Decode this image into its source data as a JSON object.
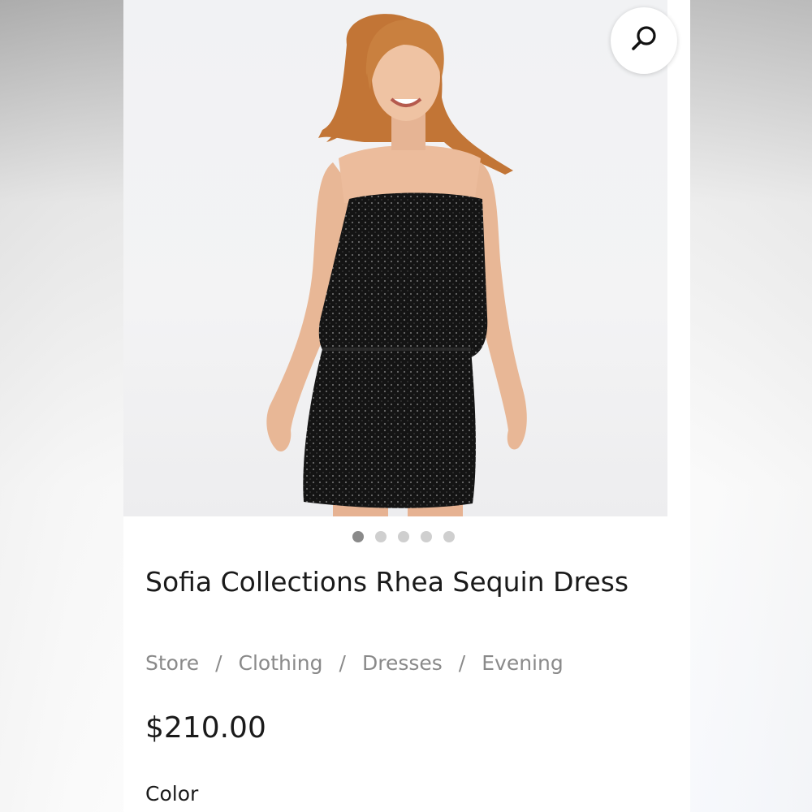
{
  "product": {
    "title": "Sofia Collections Rhea Sequin Dress",
    "price": "$210.00",
    "image_alt": "model-wearing-black-sequin-strapless-dress"
  },
  "breadcrumb": {
    "items": [
      "Store",
      "Clothing",
      "Dresses",
      "Evening"
    ],
    "separator": "/"
  },
  "carousel": {
    "total": 5,
    "active_index": 0
  },
  "options": {
    "color_label": "Color"
  },
  "icons": {
    "search": "search-icon"
  },
  "colors": {
    "text_primary": "#1a1a1a",
    "text_muted": "#8a8a8a",
    "dot_active": "#8a8a8a",
    "dot_inactive": "#cfcfcf",
    "dress": "#111111",
    "hair": "#c77a3f",
    "skin": "#e9b998"
  }
}
